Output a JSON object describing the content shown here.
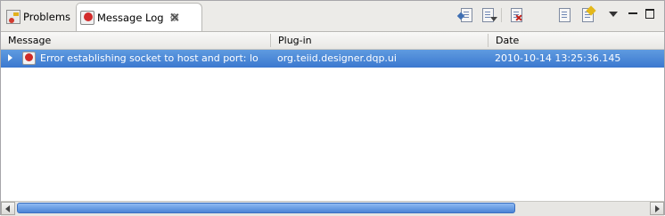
{
  "tabs": [
    {
      "label": "Problems",
      "icon": "problems-icon",
      "active": false
    },
    {
      "label": "Message Log",
      "icon": "message-log-icon",
      "active": true
    }
  ],
  "toolbar": {
    "items": [
      "export-log-icon",
      "import-log-icon",
      "clear-log-viewer-icon",
      "delete-log-icon",
      "open-log-icon",
      "restore-log-icon",
      "view-menu-icon",
      "minimize-icon",
      "maximize-icon"
    ]
  },
  "table": {
    "columns": [
      "Message",
      "Plug-in",
      "Date"
    ],
    "rows": [
      {
        "message": "Error establishing socket to host and port: lo",
        "plugin": "org.teiid.designer.dqp.ui",
        "date": "2010-10-14 13:25:36.145",
        "severity": "error",
        "selected": true
      }
    ]
  },
  "colors": {
    "selection": "#3b78cf",
    "tab_bar": "#ecebe8",
    "error": "#cf2a27",
    "scroll_thumb": "#4a84d6"
  }
}
